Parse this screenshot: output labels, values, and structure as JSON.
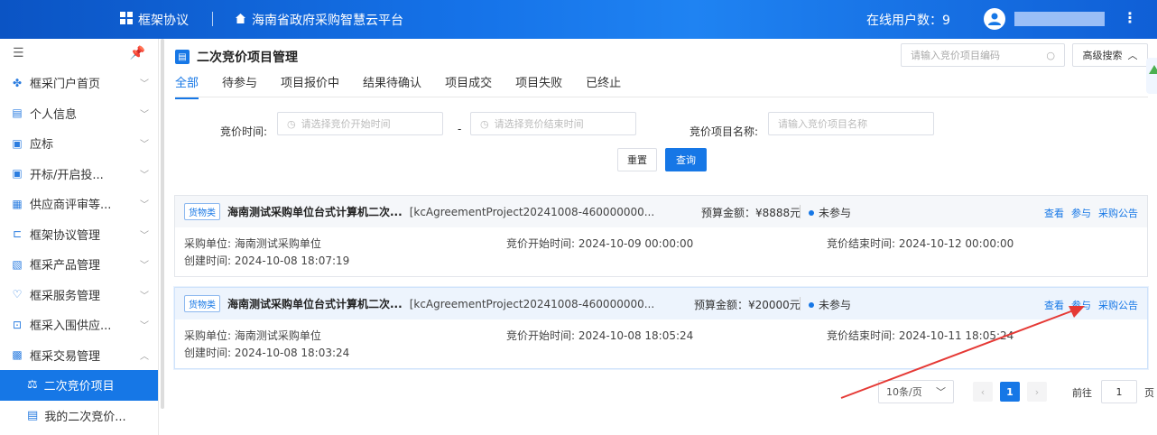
{
  "topbar": {
    "app_name": "框架协议",
    "platform_name": "海南省政府采购智慧云平台",
    "online_label": "在线用户数：9"
  },
  "sidebar": {
    "items": [
      {
        "label": "框采门户首页",
        "icon": "apps-icon",
        "chevron": "﹀"
      },
      {
        "label": "个人信息",
        "icon": "profile-icon",
        "chevron": "﹀"
      },
      {
        "label": "应标",
        "icon": "bid-icon",
        "chevron": "﹀"
      },
      {
        "label": "开标/开启投...",
        "icon": "open-bid-icon",
        "chevron": "﹀"
      },
      {
        "label": "供应商评审等...",
        "icon": "review-icon",
        "chevron": "﹀"
      },
      {
        "label": "框架协议管理",
        "icon": "agreement-icon",
        "chevron": "﹀"
      },
      {
        "label": "框采产品管理",
        "icon": "product-icon",
        "chevron": "﹀"
      },
      {
        "label": "框采服务管理",
        "icon": "service-icon",
        "chevron": "﹀"
      },
      {
        "label": "框采入围供应...",
        "icon": "supplier-icon",
        "chevron": "﹀"
      },
      {
        "label": "框采交易管理",
        "icon": "trade-icon",
        "chevron": "︿"
      }
    ],
    "sub_items": [
      {
        "label": "二次竞价项目",
        "icon": "gavel-icon"
      },
      {
        "label": "我的二次竞价...",
        "icon": "my-bid-icon"
      }
    ]
  },
  "main": {
    "title": "二次竞价项目管理",
    "search_placeholder": "请输入竞价项目编码",
    "advanced_search": "高级搜索",
    "tabs": [
      "全部",
      "待参与",
      "项目报价中",
      "结果待确认",
      "项目成交",
      "项目失败",
      "已终止"
    ],
    "filters": {
      "time_label": "竞价时间:",
      "start_placeholder": "请选择竞价开始时间",
      "dash": "-",
      "end_placeholder": "请选择竞价结束时间",
      "name_label": "竞价项目名称:",
      "name_placeholder": "请输入竞价项目名称",
      "reset": "重置",
      "query": "查询"
    },
    "cards": [
      {
        "tag": "货物类",
        "name": "海南测试采购单位台式计算机二次...",
        "code": "[kcAgreementProject20241008-460000000...",
        "budget": "预算金额：¥8888元",
        "status": "未参与",
        "actions": [
          "查看",
          "参与",
          "采购公告"
        ],
        "buyer": "采购单位: 海南测试采购单位",
        "start": "竞价开始时间: 2024-10-09 00:00:00",
        "end": "竞价结束时间: 2024-10-12 00:00:00",
        "created": "创建时间: 2024-10-08 18:07:19"
      },
      {
        "tag": "货物类",
        "name": "海南测试采购单位台式计算机二次...",
        "code": "[kcAgreementProject20241008-460000000...",
        "budget": "预算金额：¥20000元",
        "status": "未参与",
        "actions": [
          "查看",
          "参与",
          "采购公告"
        ],
        "buyer": "采购单位: 海南测试采购单位",
        "start": "竞价开始时间: 2024-10-08 18:05:24",
        "end": "竞价结束时间: 2024-10-11 18:05:24",
        "created": "创建时间: 2024-10-08 18:03:24"
      }
    ],
    "pagination": {
      "page_size": "10条/页",
      "current": "1",
      "goto_label": "前往",
      "goto_value": "1",
      "page_word": "页"
    }
  },
  "colors": {
    "accent": "#1677e6",
    "annotation_arrow": "#e53935"
  }
}
